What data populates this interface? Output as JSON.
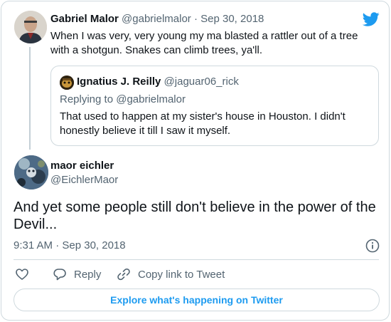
{
  "parent_tweet": {
    "author_name": "Gabriel Malor",
    "handle": "@gabrielmalor",
    "separator": "·",
    "date": "Sep 30, 2018",
    "text": "When I was very, very young my ma blasted a rattler out of a tree with a shotgun. Snakes can climb trees, ya'll."
  },
  "quoted_tweet": {
    "author_name": "Ignatius J. Reilly",
    "handle": "@jaguar06_rick",
    "replying_to": "Replying to @gabrielmalor",
    "text": "That used to happen at my sister's house in Houston. I didn't honestly believe it till I saw it myself."
  },
  "main_tweet": {
    "author_name": "maor eichler",
    "handle": "@EichlerMaor",
    "text": "And yet some people still don't believe in the power of the Devil...",
    "timestamp": "9:31 AM · Sep 30, 2018"
  },
  "actions": {
    "like_label": "",
    "reply_label": "Reply",
    "copy_link_label": "Copy link to Tweet"
  },
  "explore_button": "Explore what's happening on Twitter",
  "icons": {
    "brand": "twitter-bird-icon",
    "info": "info-icon",
    "like": "heart-icon",
    "reply": "speech-bubble-icon",
    "copy": "link-icon"
  },
  "colors": {
    "accent": "#1d9bf0",
    "text": "#0f1419",
    "muted": "#536471",
    "border": "#cfd9de"
  }
}
